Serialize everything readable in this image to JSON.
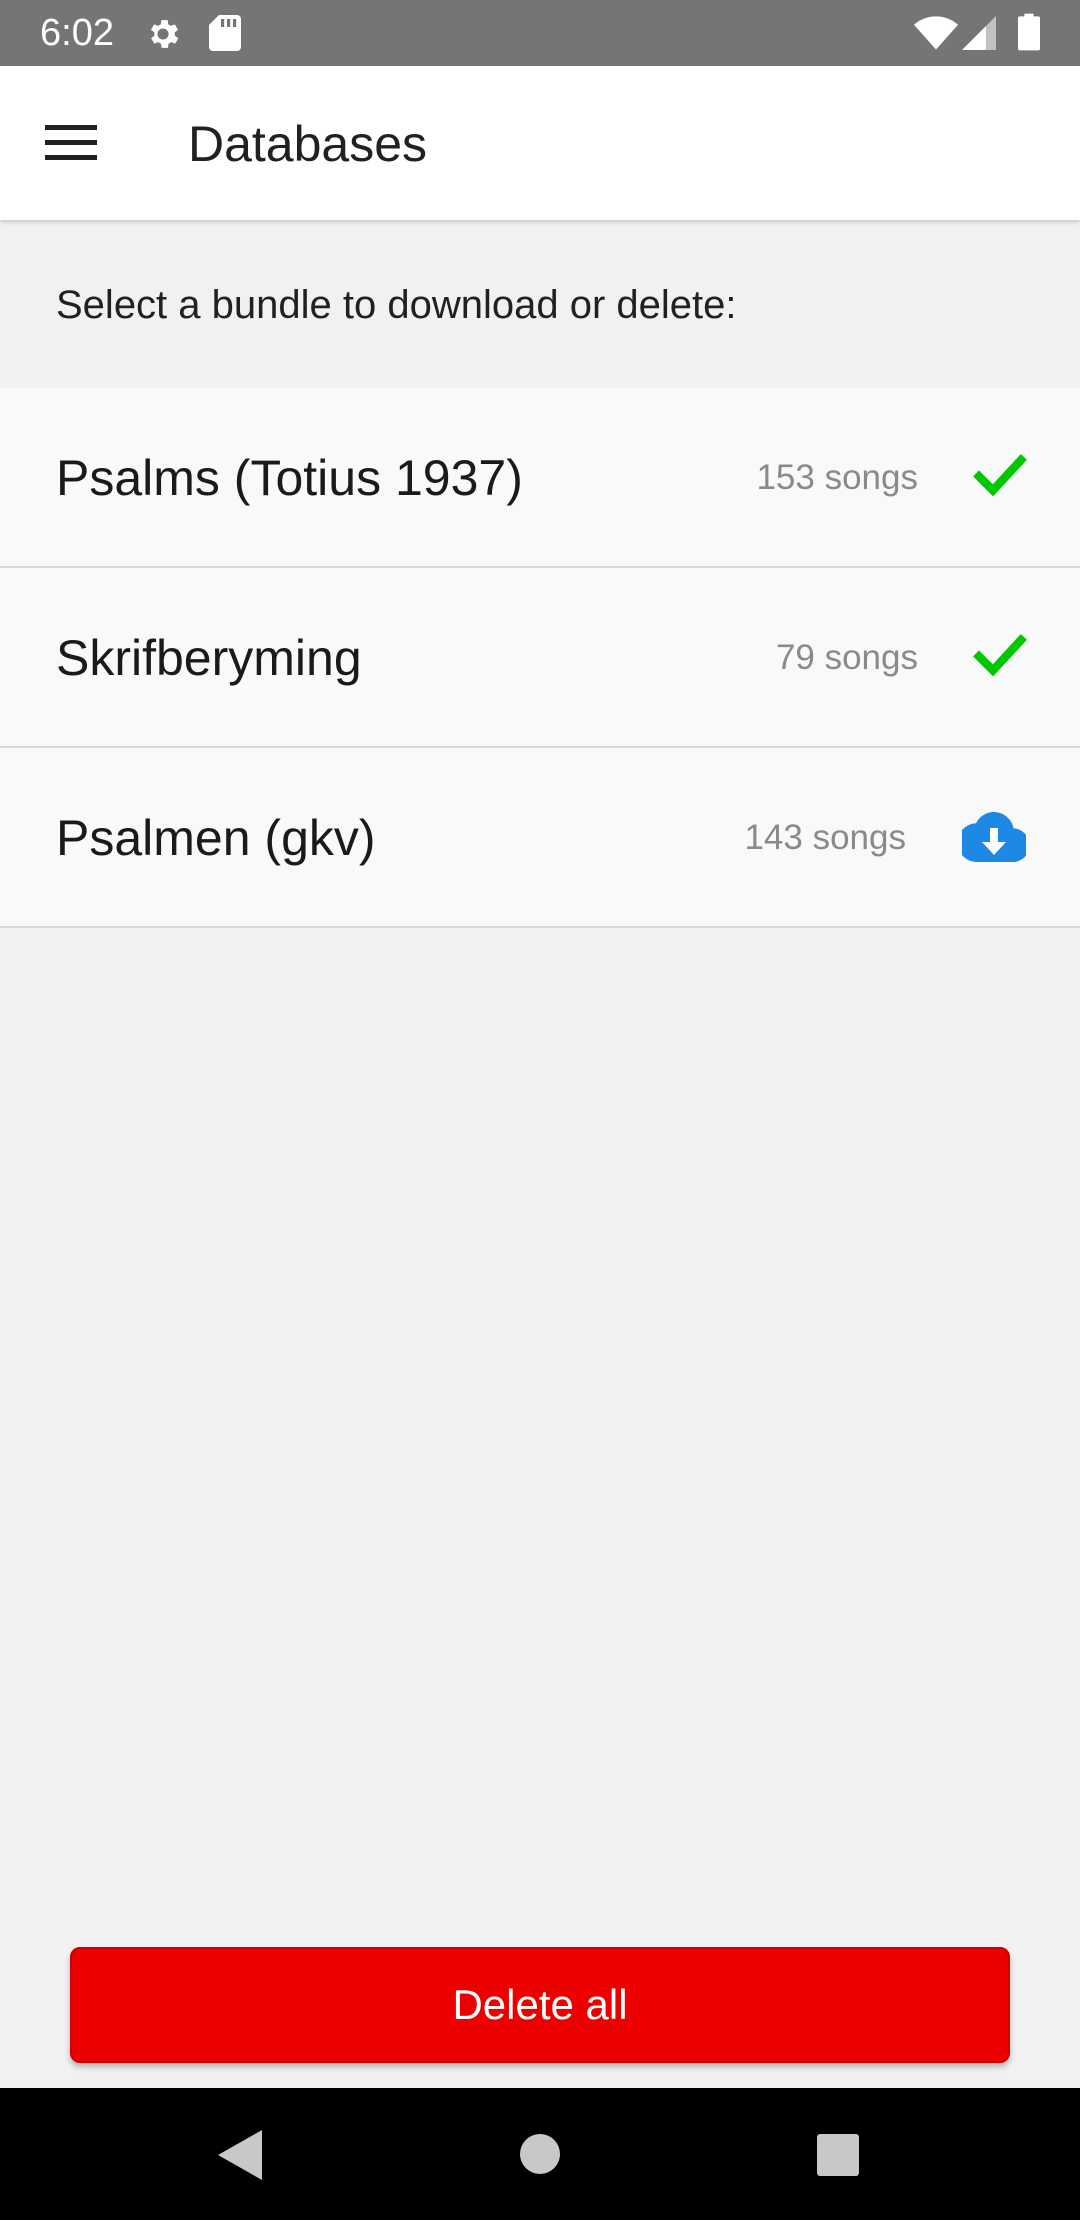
{
  "status_bar": {
    "time": "6:02",
    "icons": [
      "gear-icon",
      "sd-card-icon",
      "wifi-icon",
      "signal-icon",
      "battery-icon"
    ]
  },
  "app_bar": {
    "menu_icon": "hamburger-menu-icon",
    "title": "Databases"
  },
  "instruction": "Select a bundle to download or delete:",
  "bundles": [
    {
      "name": "Psalms (Totius 1937)",
      "count": "153 songs",
      "status_icon": "check-icon",
      "status": "downloaded"
    },
    {
      "name": "Skrifberyming",
      "count": "79 songs",
      "status_icon": "check-icon",
      "status": "downloaded"
    },
    {
      "name": "Psalmen (gkv)",
      "count": "143 songs",
      "status_icon": "cloud-download-icon",
      "status": "not downloaded"
    }
  ],
  "delete_all_label": "Delete all",
  "nav_bar": {
    "icons": [
      "back-icon",
      "home-icon",
      "recents-icon"
    ]
  },
  "colors": {
    "status_bar": "#757575",
    "accent_check": "#00c800",
    "accent_cloud": "#1e88e5",
    "delete_button": "#ec0000",
    "background": "#f1f1f1"
  }
}
